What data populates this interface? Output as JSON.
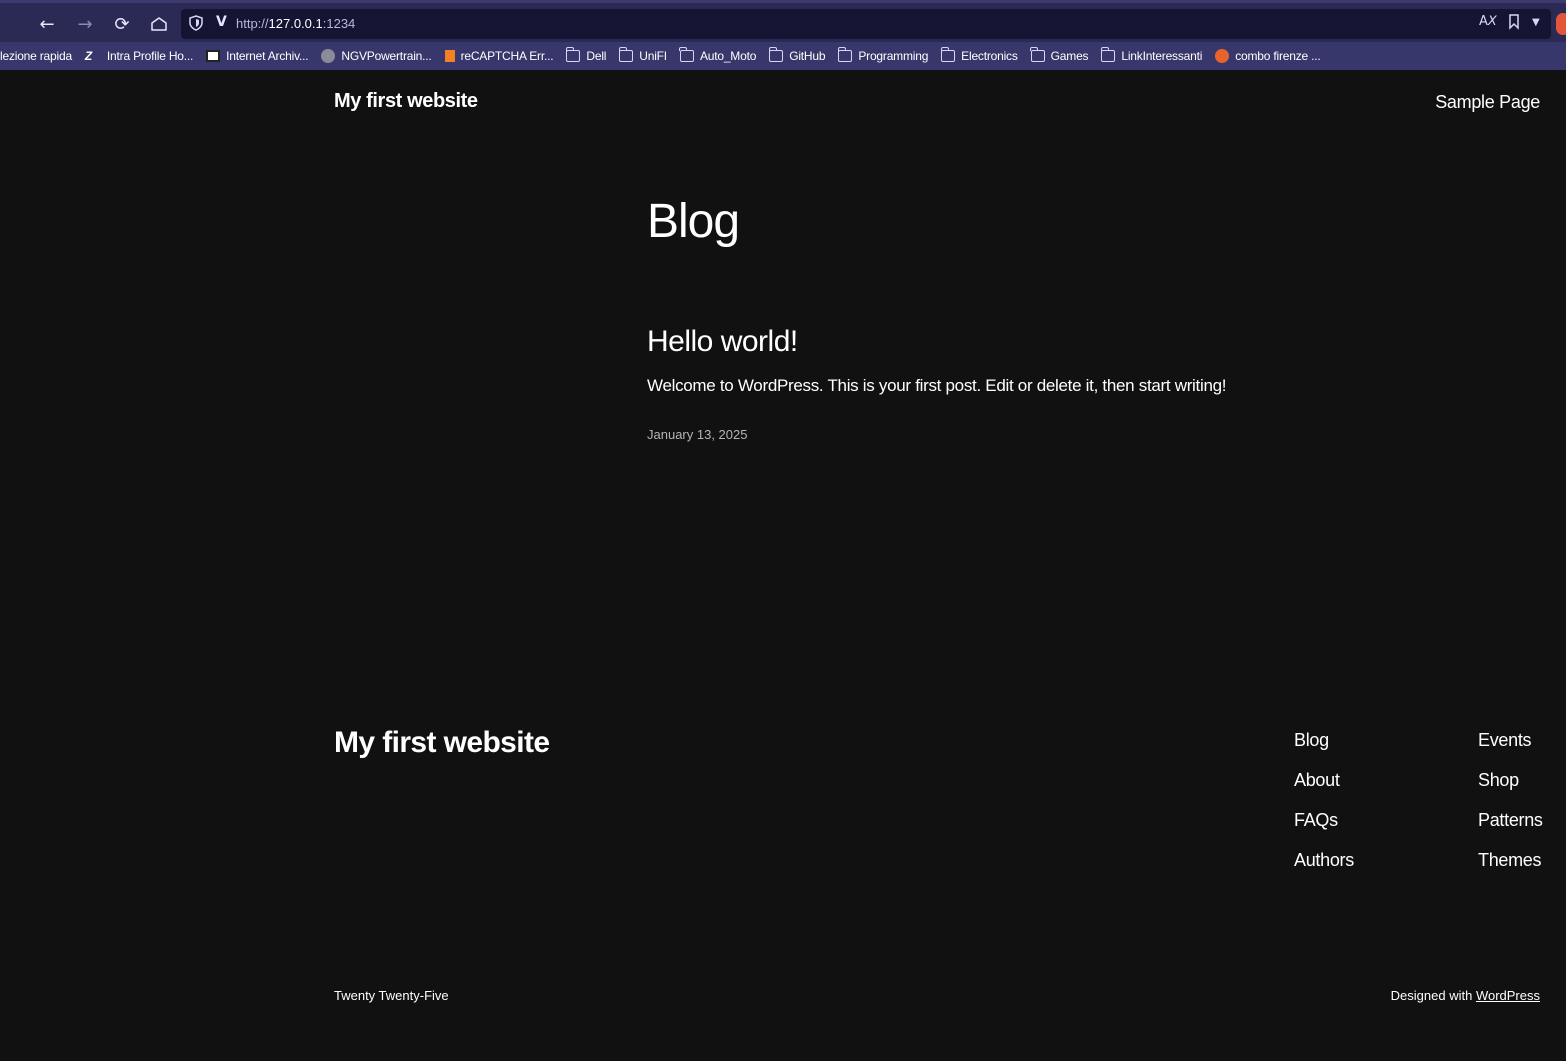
{
  "browser": {
    "url_scheme": "http://",
    "url_host": "127.0.0.1",
    "url_port": ":1234",
    "bookmarks": [
      {
        "label": "lezione rapida",
        "icon": "none"
      },
      {
        "label": "Intra Profile Ho...",
        "icon": "z-icon"
      },
      {
        "label": "Internet Archiv...",
        "icon": "archive-icon"
      },
      {
        "label": "NGVPowertrain...",
        "icon": "globe-icon"
      },
      {
        "label": "reCAPTCHA Err...",
        "icon": "stackoverflow-icon"
      },
      {
        "label": "Dell",
        "icon": "folder-icon"
      },
      {
        "label": "UniFI",
        "icon": "folder-icon"
      },
      {
        "label": "Auto_Moto",
        "icon": "folder-icon"
      },
      {
        "label": "GitHub",
        "icon": "folder-icon"
      },
      {
        "label": "Programming",
        "icon": "folder-icon"
      },
      {
        "label": "Electronics",
        "icon": "folder-icon"
      },
      {
        "label": "Games",
        "icon": "folder-icon"
      },
      {
        "label": "LinkInteressanti",
        "icon": "folder-icon"
      },
      {
        "label": "combo firenze ...",
        "icon": "firefox-icon"
      }
    ]
  },
  "header": {
    "site_title": "My first website",
    "nav_item": "Sample Page"
  },
  "main": {
    "heading": "Blog",
    "post": {
      "title": "Hello world!",
      "excerpt": "Welcome to WordPress. This is your first post. Edit or delete it, then start writing!",
      "date": "January 13, 2025"
    }
  },
  "footer": {
    "site_title": "My first website",
    "col1": [
      "Blog",
      "About",
      "FAQs",
      "Authors"
    ],
    "col2": [
      "Events",
      "Shop",
      "Patterns",
      "Themes"
    ],
    "theme_credit": "Twenty Twenty-Five",
    "designed_with": "Designed with ",
    "wordpress_link": "WordPress"
  },
  "colors": {
    "page_bg": "#111111",
    "toolbar_bg": "#2b2a54",
    "bookmarks_bg": "#38376b",
    "urlbar_bg": "#151433"
  }
}
